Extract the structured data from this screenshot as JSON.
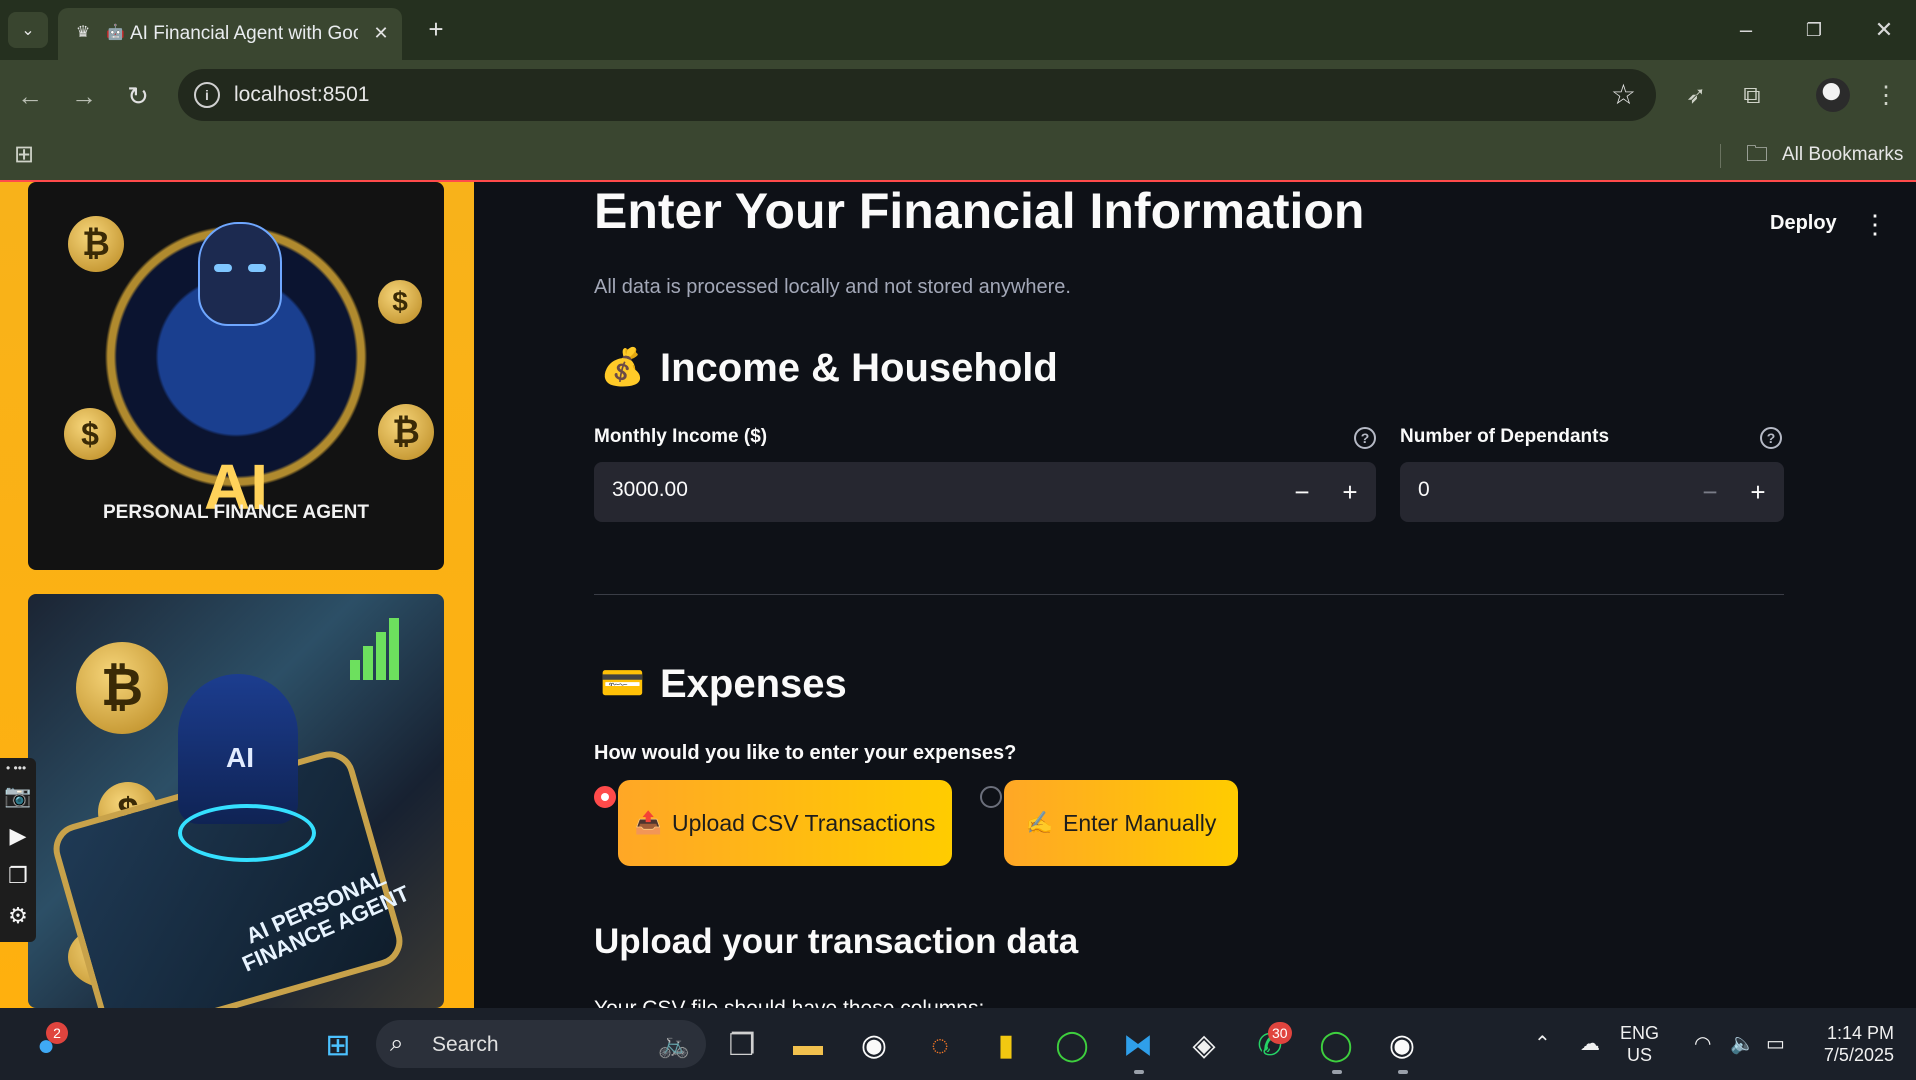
{
  "browser": {
    "tab_title": "AI Financial Agent with Goog",
    "url": "localhost:8501",
    "bookmarks_label": "All Bookmarks",
    "new_tab_symbol": "+",
    "tab_close_symbol": "✕"
  },
  "sidebar": {
    "image1_text_main": "AI",
    "image1_text_sub": "PERSONAL FINANCE AGENT",
    "image2_text_ai": "AI",
    "image2_text_phone": "AI PERSONAL FINANCE AGENT"
  },
  "header": {
    "deploy_label": "Deploy"
  },
  "main": {
    "title": "Enter Your Financial Information",
    "caption": "All data is processed locally and not stored anywhere.",
    "income_section": {
      "emoji": "💰",
      "heading": "Income & Household",
      "monthly_income": {
        "label": "Monthly Income ($)",
        "value": "3000.00"
      },
      "dependants": {
        "label": "Number of Dependants",
        "value": "0"
      }
    },
    "expenses_section": {
      "emoji": "💳",
      "heading": "Expenses",
      "question": "How would you like to enter your expenses?",
      "options": [
        {
          "icon": "📤",
          "label": "Upload CSV Transactions",
          "selected": true
        },
        {
          "icon": "✍️",
          "label": "Enter Manually",
          "selected": false
        }
      ]
    },
    "upload_heading": "Upload your transaction data",
    "upload_hint": "Your CSV file should have these columns:"
  },
  "taskbar": {
    "search_placeholder": "Search",
    "widgets_badge": "2",
    "whatsapp_badge": "30",
    "lang_line1": "ENG",
    "lang_line2": "US",
    "time": "1:14 PM",
    "date": "7/5/2025"
  },
  "colors": {
    "accent": "#ff4b4b",
    "sidebar_bg": "#ffb00e",
    "main_bg": "#0e1117",
    "input_bg": "#262730"
  }
}
